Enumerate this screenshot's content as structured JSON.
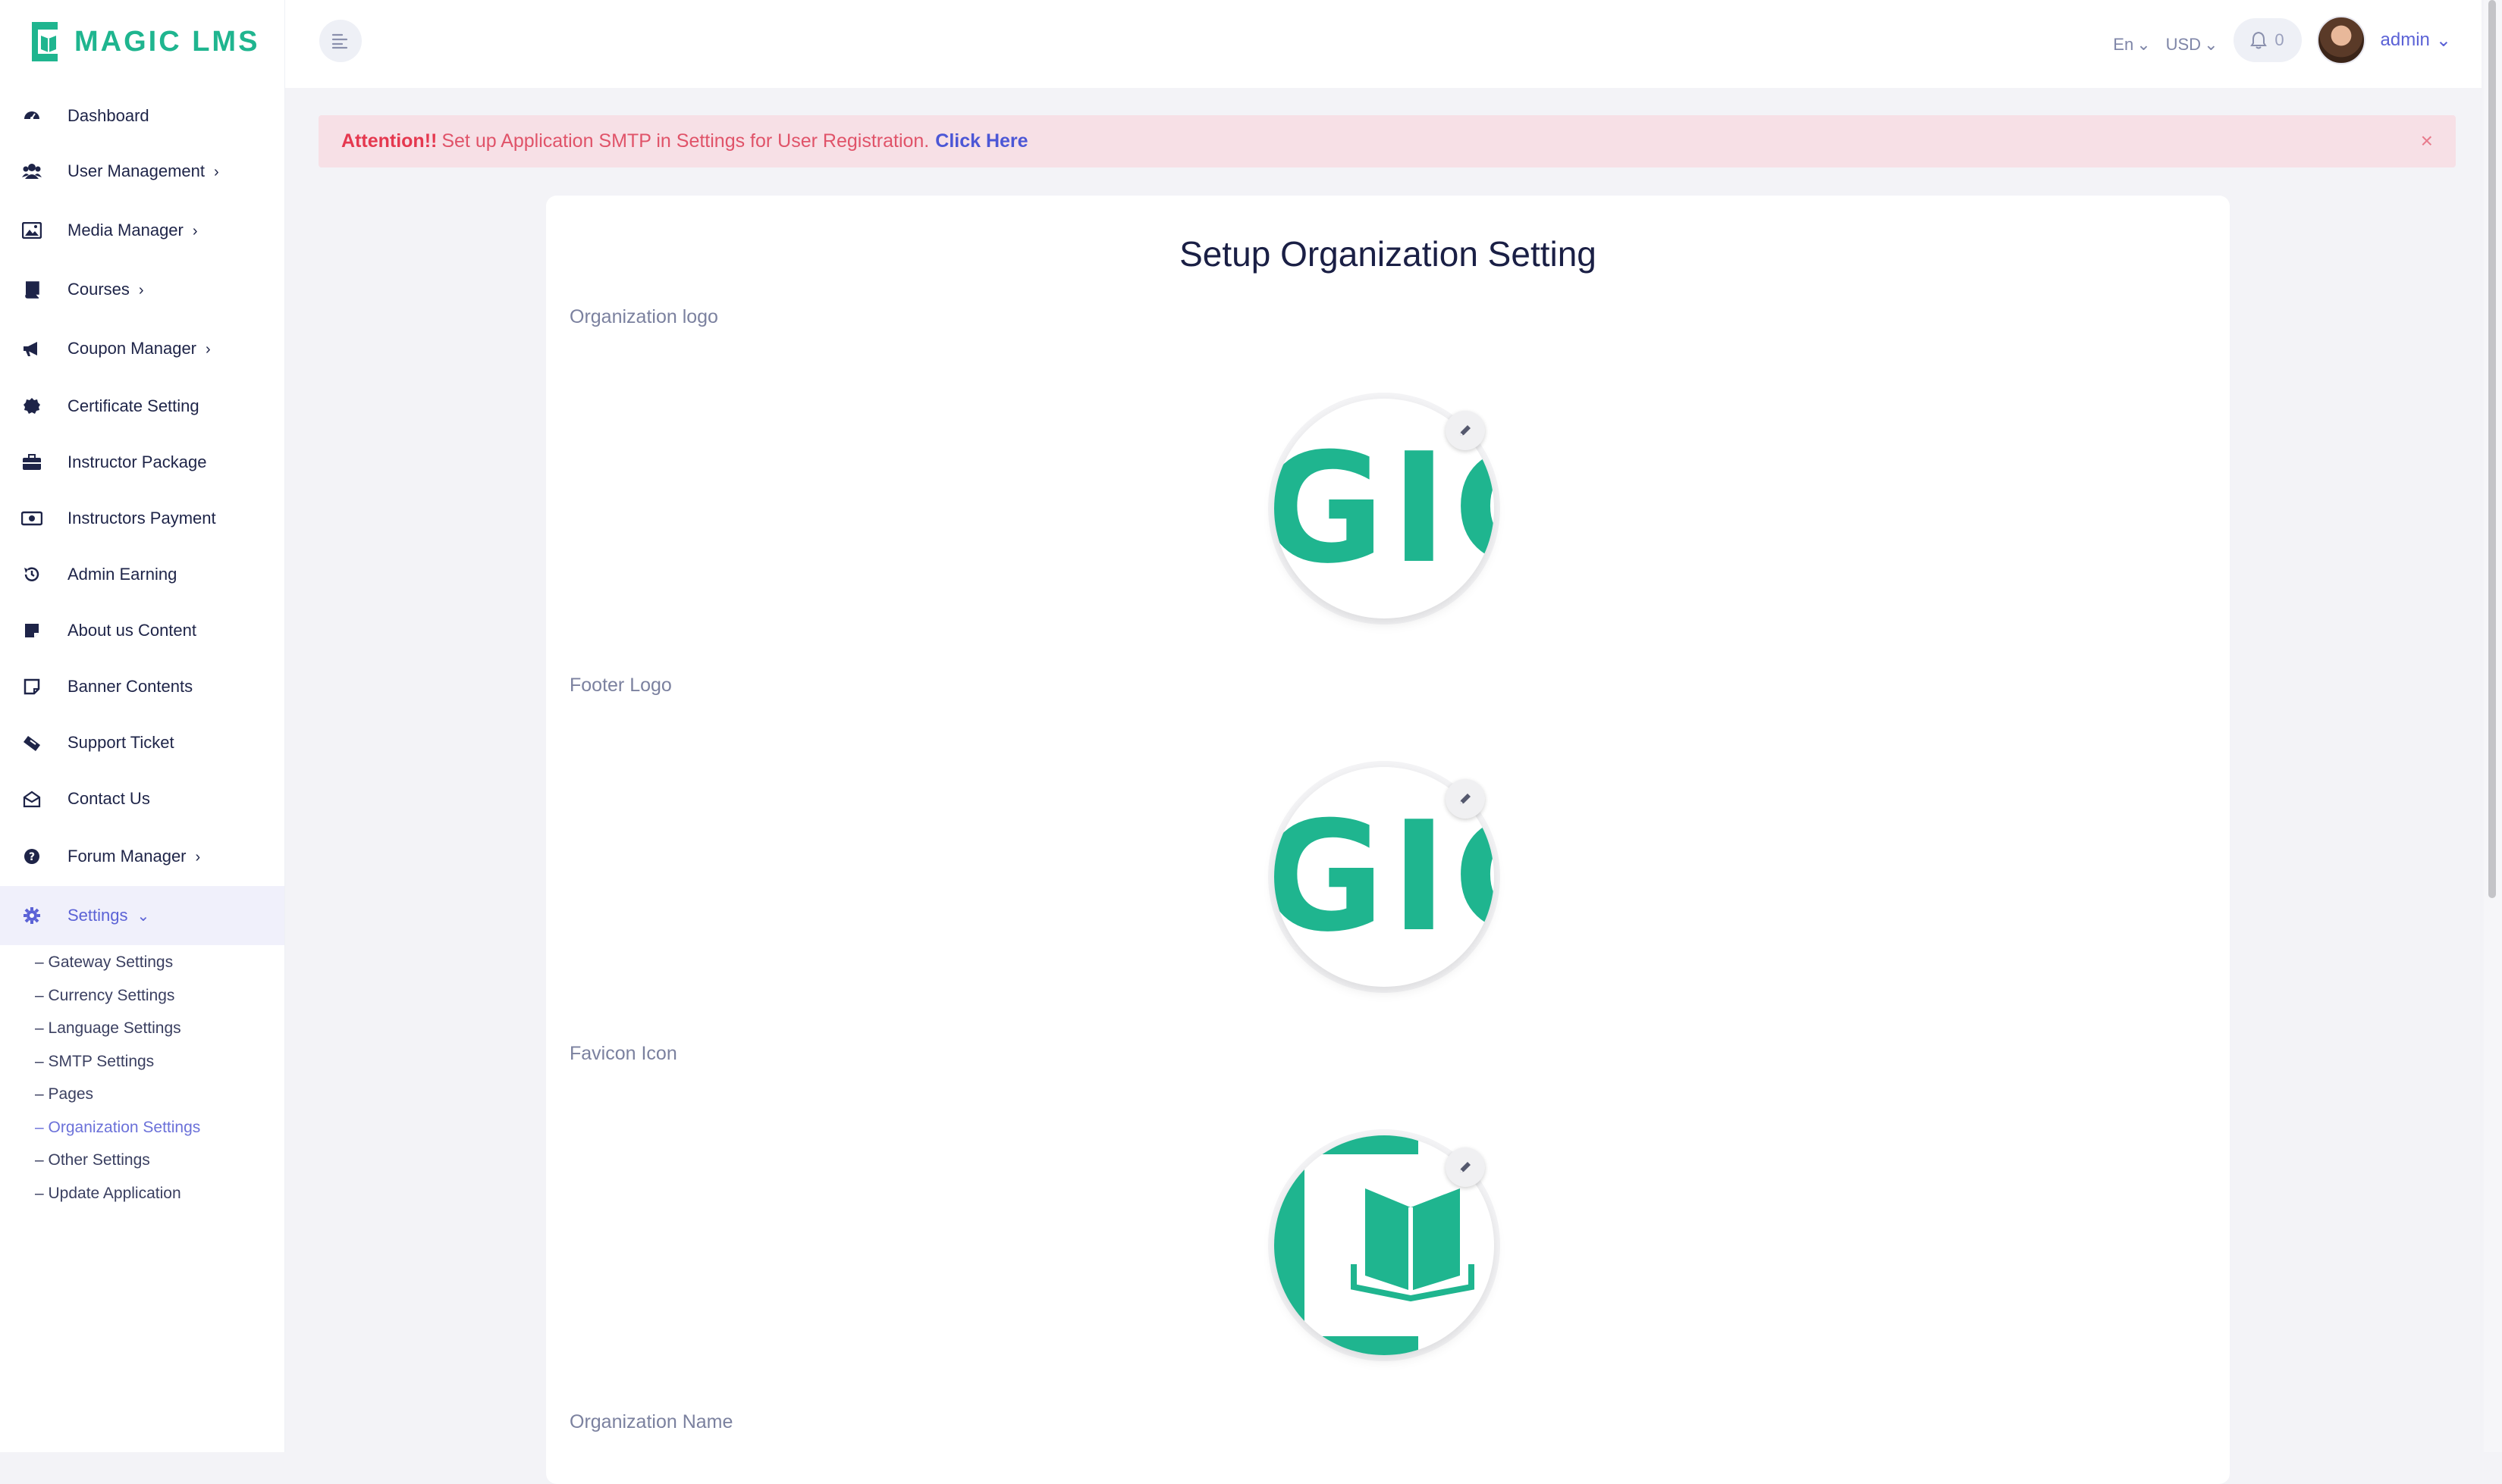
{
  "brand": {
    "name": "MAGIC LMS",
    "color": "#1fb58f"
  },
  "sidebar": {
    "items": [
      {
        "label": "Dashboard",
        "icon": "dashboard-icon",
        "has_children": false
      },
      {
        "label": "User Management",
        "icon": "users-icon",
        "has_children": true
      },
      {
        "label": "Media Manager",
        "icon": "image-icon",
        "has_children": true
      },
      {
        "label": "Courses",
        "icon": "book-icon",
        "has_children": true
      },
      {
        "label": "Coupon Manager",
        "icon": "megaphone-icon",
        "has_children": true
      },
      {
        "label": "Certificate Setting",
        "icon": "certificate-icon",
        "has_children": false
      },
      {
        "label": "Instructor Package",
        "icon": "briefcase-icon",
        "has_children": false
      },
      {
        "label": "Instructors Payment",
        "icon": "money-icon",
        "has_children": false
      },
      {
        "label": "Admin Earning",
        "icon": "history-icon",
        "has_children": false
      },
      {
        "label": "About us Content",
        "icon": "note-icon",
        "has_children": false
      },
      {
        "label": "Banner Contents",
        "icon": "sticky-note-icon",
        "has_children": false
      },
      {
        "label": "Support Ticket",
        "icon": "ticket-icon",
        "has_children": false
      },
      {
        "label": "Contact Us",
        "icon": "envelope-open-icon",
        "has_children": false
      },
      {
        "label": "Forum Manager",
        "icon": "question-icon",
        "has_children": true
      },
      {
        "label": "Settings",
        "icon": "gear-icon",
        "has_children": true,
        "active": true
      }
    ],
    "settings_children": [
      "– Gateway Settings",
      "– Currency Settings",
      "– Language Settings",
      "– SMTP Settings",
      "– Pages",
      "– Organization Settings",
      "– Other Settings",
      "– Update Application"
    ],
    "active_child": "– Organization Settings"
  },
  "topbar": {
    "language": "En",
    "currency": "USD",
    "notifications": "0",
    "user": "admin"
  },
  "alert": {
    "strong": "Attention!!",
    "message": "Set up Application SMTP in Settings for User Registration.",
    "link": "Click Here",
    "close": "×"
  },
  "page": {
    "title": "Setup Organization Setting",
    "fields": [
      {
        "label": "Organization logo",
        "logo_text": "IGIC"
      },
      {
        "label": "Footer Logo",
        "logo_text": "IGIC"
      },
      {
        "label": "Favicon Icon",
        "logo_text": ""
      },
      {
        "label": "Organization Name"
      }
    ]
  },
  "colors": {
    "accent": "#5b62d6",
    "alert_bg": "#f7e0e6",
    "alert_text": "#e5384f"
  }
}
